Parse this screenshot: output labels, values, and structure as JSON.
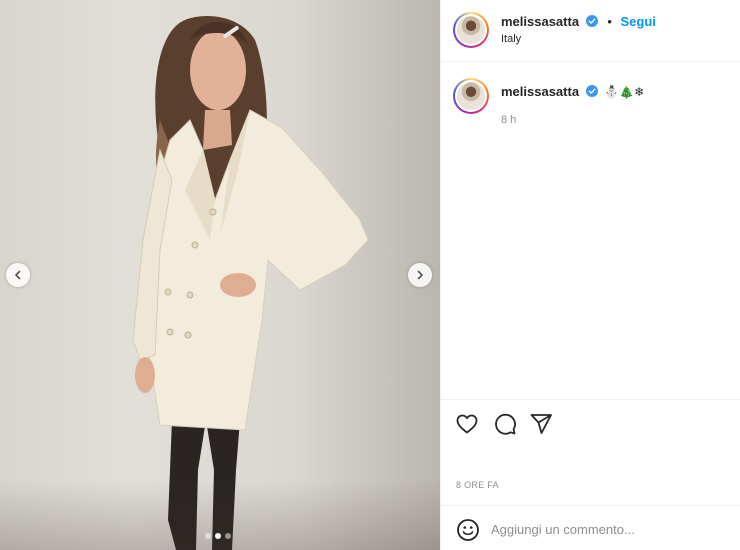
{
  "post": {
    "username": "melissasatta",
    "follow_label": "Segui",
    "bullet": "•",
    "location": "Italy",
    "caption_emojis": "⛄🎄❄",
    "caption_time": "8 h",
    "timestamp": "8 ORE FA",
    "comment_placeholder": "Aggiungi un commento...",
    "carousel": {
      "total": 3,
      "active": 2
    }
  },
  "colors": {
    "accent": "#0095f6",
    "verified": "#3897f0",
    "muted": "#8e8e8e",
    "text": "#262626"
  },
  "icons": {
    "prev": "chevron-left-icon",
    "next": "chevron-right-icon",
    "like": "heart-icon",
    "comment": "speech-bubble-icon",
    "share": "paper-plane-icon",
    "emoji": "smiley-icon",
    "verified": "verified-badge-icon"
  }
}
